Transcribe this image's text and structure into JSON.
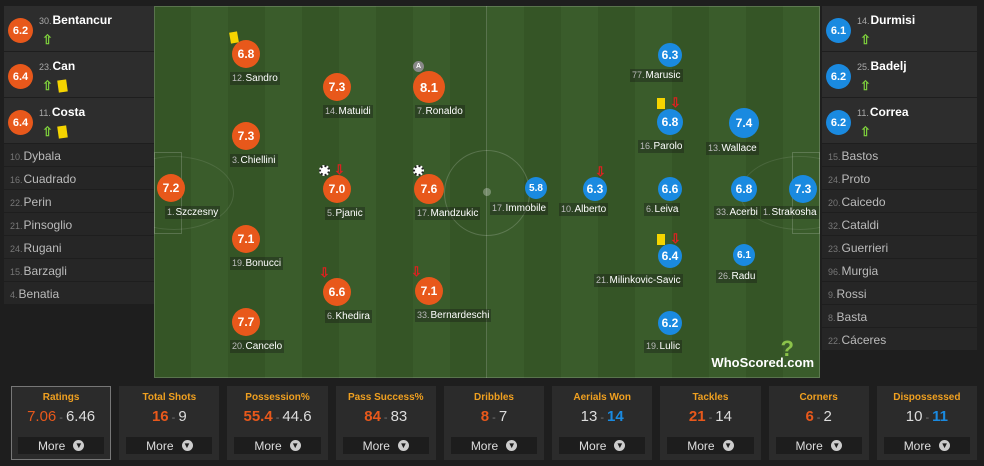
{
  "left_subs": [
    {
      "num": "30.",
      "name": "Bentancur",
      "rating": "6.2",
      "up": true,
      "yc": false
    },
    {
      "num": "23.",
      "name": "Can",
      "rating": "6.4",
      "up": true,
      "yc": true
    },
    {
      "num": "11.",
      "name": "Costa",
      "rating": "6.4",
      "up": true,
      "yc": true
    }
  ],
  "left_bench": [
    {
      "num": "10.",
      "name": "Dybala"
    },
    {
      "num": "16.",
      "name": "Cuadrado"
    },
    {
      "num": "22.",
      "name": "Perin"
    },
    {
      "num": "21.",
      "name": "Pinsoglio"
    },
    {
      "num": "24.",
      "name": "Rugani"
    },
    {
      "num": "15.",
      "name": "Barzagli"
    },
    {
      "num": "4.",
      "name": "Benatia"
    }
  ],
  "right_subs": [
    {
      "num": "14.",
      "name": "Durmisi",
      "rating": "6.1",
      "up": true
    },
    {
      "num": "25.",
      "name": "Badelj",
      "rating": "6.2",
      "up": true
    },
    {
      "num": "11.",
      "name": "Correa",
      "rating": "6.2",
      "up": true
    }
  ],
  "right_bench": [
    {
      "num": "15.",
      "name": "Bastos"
    },
    {
      "num": "24.",
      "name": "Proto"
    },
    {
      "num": "20.",
      "name": "Caicedo"
    },
    {
      "num": "32.",
      "name": "Cataldi"
    },
    {
      "num": "23.",
      "name": "Guerrieri"
    },
    {
      "num": "96.",
      "name": "Murgia"
    },
    {
      "num": "9.",
      "name": "Rossi"
    },
    {
      "num": "8.",
      "name": "Basta"
    },
    {
      "num": "22.",
      "name": "Cáceres"
    }
  ],
  "home_players": [
    {
      "num": "1.",
      "name": "Szczesny",
      "rating": "7.2"
    },
    {
      "num": "12.",
      "name": "Sandro",
      "rating": "6.8"
    },
    {
      "num": "3.",
      "name": "Chiellini",
      "rating": "7.3"
    },
    {
      "num": "19.",
      "name": "Bonucci",
      "rating": "7.1"
    },
    {
      "num": "20.",
      "name": "Cancelo",
      "rating": "7.7"
    },
    {
      "num": "14.",
      "name": "Matuidi",
      "rating": "7.3"
    },
    {
      "num": "5.",
      "name": "Pjanic",
      "rating": "7.0"
    },
    {
      "num": "6.",
      "name": "Khedira",
      "rating": "6.6"
    },
    {
      "num": "7.",
      "name": "Ronaldo",
      "rating": "8.1"
    },
    {
      "num": "17.",
      "name": "Mandzukic",
      "rating": "7.6"
    },
    {
      "num": "33.",
      "name": "Bernardeschi",
      "rating": "7.1"
    }
  ],
  "away_players": [
    {
      "num": "17.",
      "name": "Immobile",
      "rating": "5.8"
    },
    {
      "num": "10.",
      "name": "Alberto",
      "rating": "6.3"
    },
    {
      "num": "77.",
      "name": "Marusic",
      "rating": "6.3"
    },
    {
      "num": "16.",
      "name": "Parolo",
      "rating": "6.8"
    },
    {
      "num": "6.",
      "name": "Leiva",
      "rating": "6.6"
    },
    {
      "num": "21.",
      "name": "Milinkovic-Savic",
      "rating": "6.4"
    },
    {
      "num": "19.",
      "name": "Lulic",
      "rating": "6.2"
    },
    {
      "num": "13.",
      "name": "Wallace",
      "rating": "7.4"
    },
    {
      "num": "33.",
      "name": "Acerbi",
      "rating": "6.8"
    },
    {
      "num": "26.",
      "name": "Radu",
      "rating": "6.1"
    },
    {
      "num": "1.",
      "name": "Strakosha",
      "rating": "7.3"
    }
  ],
  "captain_badge": "A",
  "logo": {
    "text": "WhoScored",
    "suffix": ".com",
    "mark": "?"
  },
  "stats": [
    {
      "title": "Ratings",
      "home": "7.06",
      "away": "6.46",
      "more": "More",
      "active": true
    },
    {
      "title": "Total Shots",
      "home": "16",
      "away": "9",
      "more": "More"
    },
    {
      "title": "Possession%",
      "home": "55.4",
      "away": "44.6",
      "more": "More"
    },
    {
      "title": "Pass Success%",
      "home": "84",
      "away": "83",
      "more": "More"
    },
    {
      "title": "Dribbles",
      "home": "8",
      "away": "7",
      "more": "More"
    },
    {
      "title": "Aerials Won",
      "home": "13",
      "away": "14",
      "more": "More"
    },
    {
      "title": "Tackles",
      "home": "21",
      "away": "14",
      "more": "More"
    },
    {
      "title": "Corners",
      "home": "6",
      "away": "2",
      "more": "More"
    },
    {
      "title": "Dispossessed",
      "home": "10",
      "away": "11",
      "more": "More"
    }
  ],
  "colors": {
    "home": "#e8581b",
    "away": "#1a8ae0",
    "stat_title": "#f0a020",
    "pitch_dark": "#355526",
    "pitch_light": "#3a5c2b"
  }
}
